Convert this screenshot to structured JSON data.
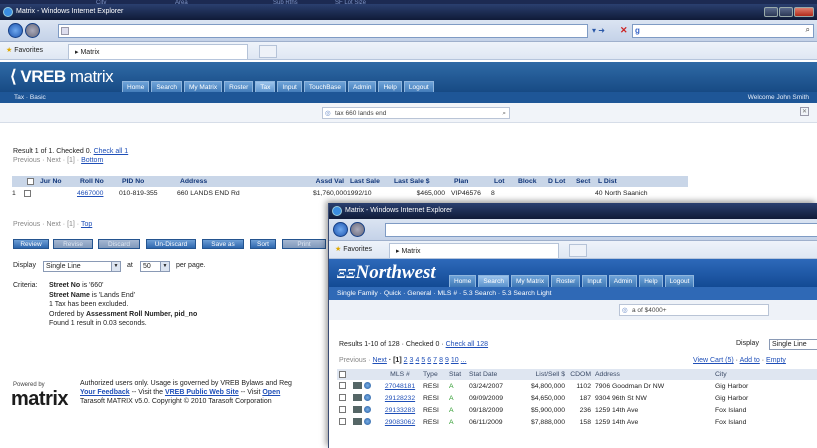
{
  "desktop": {
    "bg_fragments": [
      "City",
      "Area",
      "Sub Rths",
      "SF Lot Size"
    ]
  },
  "browser1": {
    "title": "Matrix - Windows Internet Explorer",
    "address": "",
    "search_engine": "Google",
    "favorites_label": "Favorites",
    "tab_label": "Matrix"
  },
  "vreb": {
    "logo_a": "VREB",
    "logo_b": "matrix",
    "nav": [
      "Home",
      "Search",
      "My Matrix",
      "Roster",
      "Tax",
      "Input",
      "TouchBase",
      "Admin",
      "Help",
      "Logout"
    ],
    "nav_active": 4,
    "subnav": "Tax · Basic",
    "welcome": "Welcome John Smith",
    "search_text": "tax 660 lands end",
    "result_prefix": "Result 1 of 1. Checked 0.",
    "check_all": "Check all 1",
    "pager_top_prefix": "Previous · Next · [1] ·",
    "pager_top_link": "Bottom",
    "grid_headers": [
      "Jur No",
      "Roll No",
      "PID No",
      "Address",
      "Assd Val",
      "Last Sale",
      "Last Sale $",
      "Plan",
      "Lot",
      "Block",
      "D Lot",
      "Sect",
      "L Dist"
    ],
    "row": {
      "num": "1",
      "roll": "4667000",
      "pid": "010-819-355",
      "address": "660 LANDS END Rd",
      "assd": "$1,760,000",
      "last_sale": "1992/10",
      "last_sale_amt": "$465,000",
      "plan": "VIP46576",
      "lot": "8",
      "ldist": "40 North Saanich"
    },
    "pager_bottom_prefix": "Previous · Next · [1] ·",
    "pager_bottom_link": "Top",
    "buttons": [
      "Review",
      "Revise",
      "Discard",
      "Un-Discard",
      "Save as",
      "Sort",
      "Print"
    ],
    "display_label": "Display",
    "display_value": "Single Line",
    "at_label": "at",
    "per_page_value": "50",
    "per_page_label": "per page.",
    "criteria_label": "Criteria:",
    "criteria_lines": [
      {
        "bold": "Street No",
        "text": " is '660'"
      },
      {
        "bold": "Street Name",
        "text": " is 'Lands End'"
      },
      {
        "bold": "",
        "text": "1 Tax has been excluded."
      },
      {
        "bold": "",
        "text": "Ordered by "
      },
      {
        "bold": "",
        "text": "Found 1 result in 0.03 seconds."
      }
    ],
    "ordered_by_bold": "Assessment Roll Number, pid_no",
    "powered_by": "Powered by",
    "footer_logo": "matrix",
    "footer_l1": "Authorized users only.  Usage is governed by VREB Bylaws and Reg",
    "footer_l2_a": "Your Feedback",
    "footer_l2_b": " -- Visit the ",
    "footer_l2_c": "VREB Public Web Site",
    "footer_l2_d": " -- Visit ",
    "footer_l2_e": "Open",
    "footer_l3": "Tarasoft MATRIX v5.0. Copyright © 2010 Tarasoft Corporation"
  },
  "browser2": {
    "title": "Matrix - Windows Internet Explorer",
    "favorites_label": "Favorites",
    "tab_label": "Matrix"
  },
  "nw": {
    "logo": "Northwest",
    "nav": [
      "Home",
      "Search",
      "My Matrix",
      "Roster",
      "Input",
      "Admin",
      "Help",
      "Logout"
    ],
    "nav_active": 1,
    "subnav": "Single Family · Quick · General · MLS # · 5.3 Search · 5.3 Search Light",
    "search_text": "a of $4000+",
    "results_prefix": "Results 1-10 of 128 · Checked 0 ·",
    "check_all": "Check all 128",
    "display_label": "Display",
    "display_value": "Single Line",
    "pager_prefix": "Previous ·",
    "pager_next": "Next",
    "pager_current": "· [1]",
    "pager_pages": [
      "2",
      "3",
      "4",
      "5",
      "6",
      "7",
      "8",
      "9",
      "10",
      "..."
    ],
    "view_cart": "View Cart (5)",
    "add_to": "Add to",
    "empty": "Empty",
    "headers": [
      "MLS #",
      "Type",
      "Stat",
      "Stat Date",
      "List/Sell $",
      "CDOM",
      "Address",
      "City"
    ],
    "rows": [
      {
        "mls": "27048181",
        "type": "RESI",
        "stat": "A",
        "date": "03/24/2007",
        "price": "$4,800,000",
        "cdom": "1102",
        "address": "7906 Goodman Dr NW",
        "city": "Gig Harbor"
      },
      {
        "mls": "29128232",
        "type": "RESI",
        "stat": "A",
        "date": "09/09/2009",
        "price": "$4,650,000",
        "cdom": "187",
        "address": "9304 96th St NW",
        "city": "Gig Harbor"
      },
      {
        "mls": "29133283",
        "type": "RESI",
        "stat": "A",
        "date": "09/18/2009",
        "price": "$5,900,000",
        "cdom": "236",
        "address": "1259 14th Ave",
        "city": "Fox Island"
      },
      {
        "mls": "29083062",
        "type": "RESI",
        "stat": "A",
        "date": "06/11/2009",
        "price": "$7,888,000",
        "cdom": "158",
        "address": "1259 14th Ave",
        "city": "Fox Island"
      }
    ]
  }
}
